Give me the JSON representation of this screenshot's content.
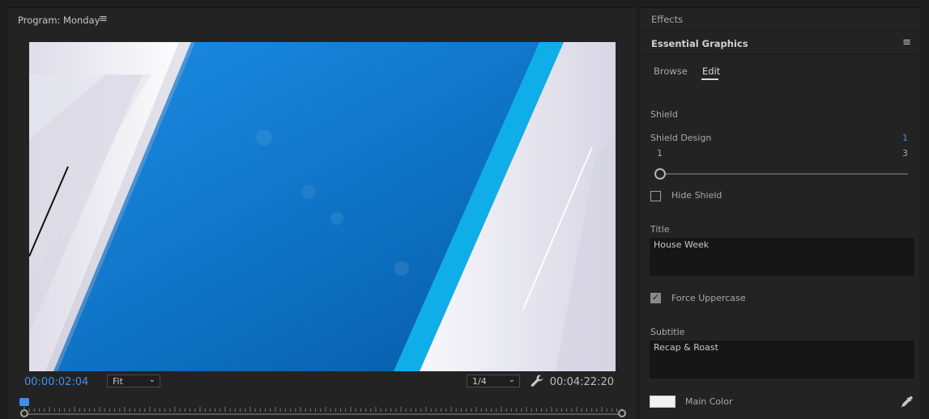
{
  "program_panel": {
    "title": "Program: Monday",
    "menu_icon": "hamburger-menu-icon",
    "current_timecode": "00:00:02:04",
    "duration_timecode": "00:04:22:20",
    "zoom_select": "Fit",
    "resolution_select": "1/4",
    "settings_icon": "wrench-icon"
  },
  "effects_tab": {
    "label": "Effects"
  },
  "essential_graphics": {
    "title": "Essential Graphics",
    "tabs": [
      {
        "label": "Browse",
        "active": false
      },
      {
        "label": "Edit",
        "active": true
      }
    ],
    "shield_section": "Shield",
    "shield_design": {
      "label": "Shield Design",
      "value": "1",
      "min": "1",
      "max": "3",
      "slider_fraction": 0
    },
    "hide_shield": {
      "label": "Hide Shield",
      "checked": false
    },
    "title_field": {
      "label": "Title",
      "value": "House Week"
    },
    "force_uppercase": {
      "label": "Force Uppercase",
      "checked": true
    },
    "subtitle_field": {
      "label": "Subtitle",
      "value": "Recap & Roast"
    },
    "main_color": {
      "label": "Main Color",
      "color": "#f2f2f2",
      "picker_icon": "eyedropper-icon"
    }
  },
  "colors": {
    "accent": "#3f8fe8",
    "panel_bg": "#232323"
  }
}
